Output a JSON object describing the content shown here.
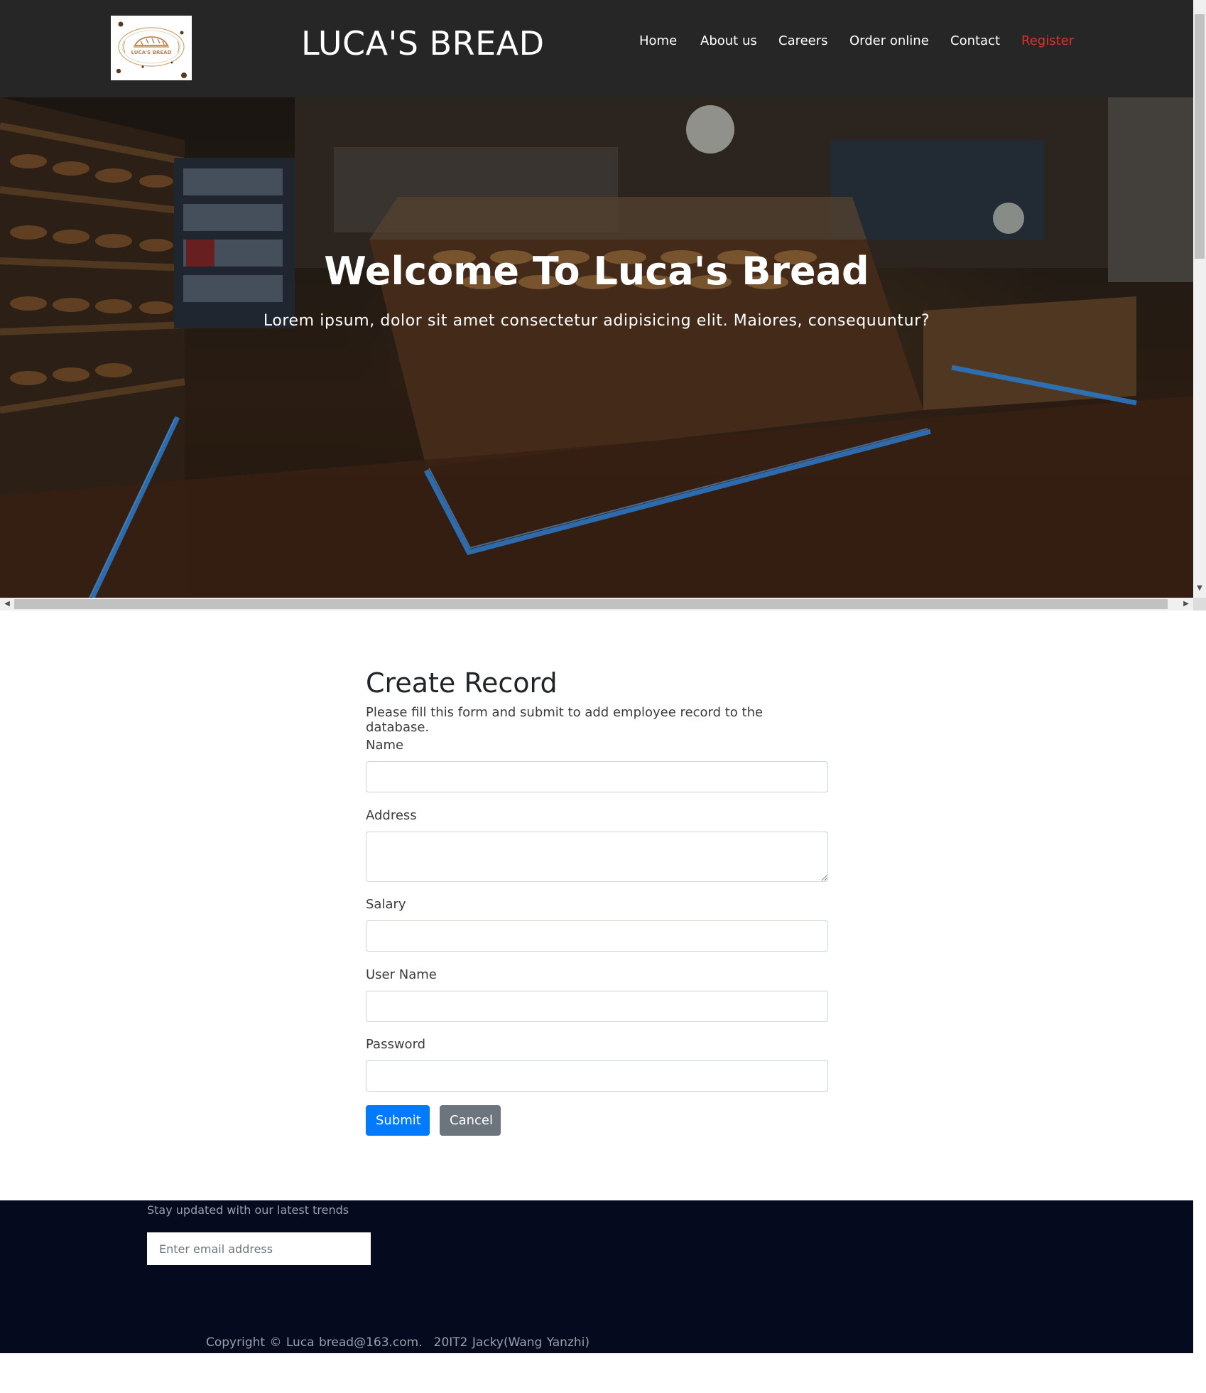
{
  "header": {
    "logo_text": "LUCA'S BREAD",
    "site_title": "LUCA'S BREAD",
    "nav": [
      {
        "label": "Home"
      },
      {
        "label": "About us"
      },
      {
        "label": "Careers"
      },
      {
        "label": "Order online"
      },
      {
        "label": "Contact"
      },
      {
        "label": "Register",
        "highlight": true
      }
    ],
    "accent_color": "#d9342b"
  },
  "hero": {
    "title": "Welcome To Luca's Bread",
    "subtitle": "Lorem ipsum, dolor sit amet consectetur adipisicing elit. Maiores, consequuntur?"
  },
  "form": {
    "title": "Create Record",
    "description": "Please fill this form and submit to add employee record to the database.",
    "fields": [
      {
        "label": "Name",
        "value": ""
      },
      {
        "label": "Address",
        "value": ""
      },
      {
        "label": "Salary",
        "value": ""
      },
      {
        "label": "User Name",
        "value": ""
      },
      {
        "label": "Password",
        "value": ""
      }
    ],
    "submit_label": "Submit",
    "cancel_label": "Cancel",
    "submit_color": "#007bff",
    "cancel_color": "#6c757d"
  },
  "footer": {
    "newsletter_text": "Stay updated with our latest trends",
    "email_placeholder": "Enter email address",
    "copyright": "Copyright © Luca bread@163.com.",
    "credit": "20IT2 Jacky(Wang Yanzhi)"
  },
  "icons": {
    "scroll_up": "scroll-up-arrow-icon",
    "scroll_down": "scroll-down-arrow-icon",
    "scroll_left": "scroll-left-arrow-icon",
    "scroll_right": "scroll-right-arrow-icon"
  }
}
